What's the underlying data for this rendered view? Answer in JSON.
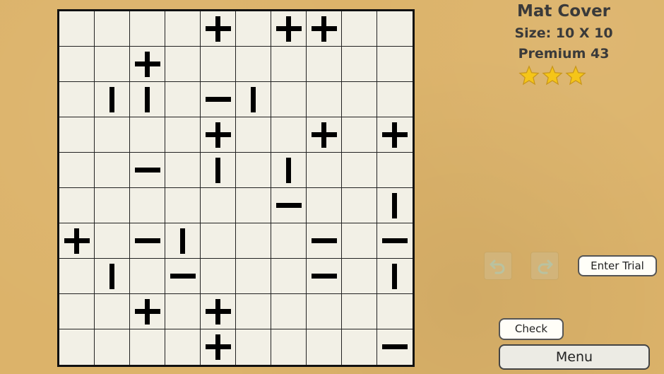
{
  "puzzle": {
    "title": "Mat Cover",
    "size_label": "Size: 10 X 10",
    "level_label": "Premium 43",
    "stars": 3,
    "star_color": "#f5c518",
    "grid": [
      [
        "",
        "",
        "",
        "",
        "+",
        "",
        "+",
        "+",
        "",
        ""
      ],
      [
        "",
        "",
        "+",
        "",
        "",
        "",
        "",
        "",
        "",
        ""
      ],
      [
        "",
        "|",
        "|",
        "",
        "-",
        "|",
        "",
        "",
        "",
        ""
      ],
      [
        "",
        "",
        "",
        "",
        "+",
        "",
        "",
        "+",
        "",
        "+"
      ],
      [
        "",
        "",
        "-",
        "",
        "|",
        "",
        "|",
        "",
        "",
        ""
      ],
      [
        "",
        "",
        "",
        "",
        "",
        "",
        "-",
        "",
        "",
        "|"
      ],
      [
        "+",
        "",
        "-",
        "|",
        "",
        "",
        "",
        "-",
        "",
        "-"
      ],
      [
        "",
        "|",
        "",
        "-",
        "",
        "",
        "",
        "-",
        "",
        "|"
      ],
      [
        "",
        "",
        "+",
        "",
        "+",
        "",
        "",
        "",
        "",
        ""
      ],
      [
        "",
        "",
        "",
        "",
        "+",
        "",
        "",
        "",
        "",
        "-"
      ]
    ]
  },
  "controls": {
    "undo_icon": "undo-arrow-icon",
    "redo_icon": "redo-arrow-icon",
    "enter_trial_label": "Enter Trial",
    "check_label": "Check",
    "menu_label": "Menu"
  }
}
